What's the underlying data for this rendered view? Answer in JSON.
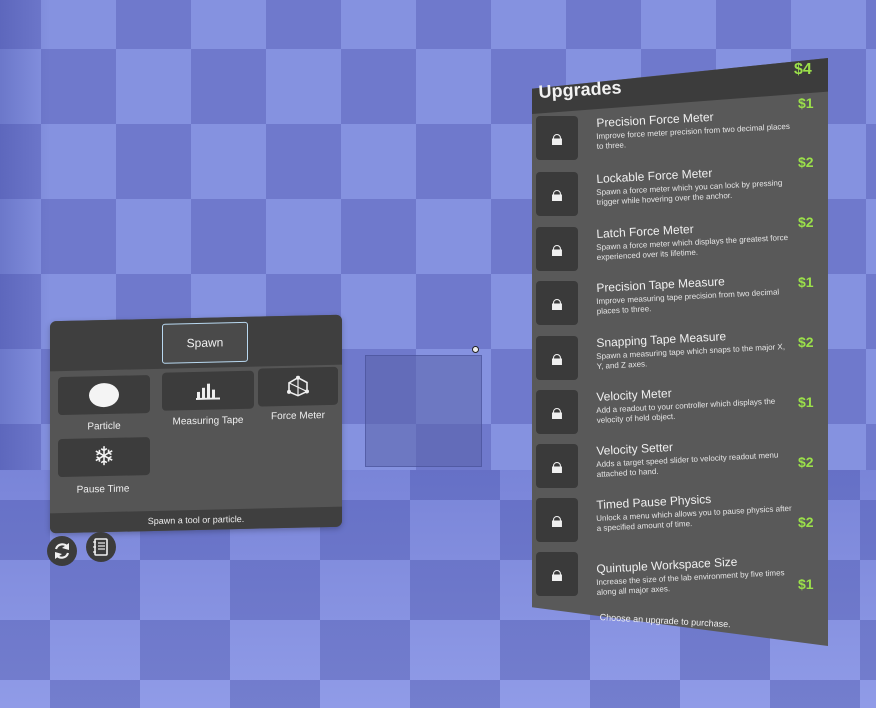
{
  "spawn_panel": {
    "tab_label": "Spawn",
    "items": [
      {
        "label": "Particle",
        "icon": "circle-icon"
      },
      {
        "label": "Measuring Tape",
        "icon": "bar-chart-icon"
      },
      {
        "label": "Force Meter",
        "icon": "force-meter-icon"
      },
      {
        "label": "Pause Time",
        "icon": "snowflake-icon"
      }
    ],
    "footer": "Spawn a tool or particle."
  },
  "bottom_buttons": [
    {
      "icon": "reset-icon"
    },
    {
      "icon": "notebook-icon"
    }
  ],
  "upgrades": {
    "title": "Upgrades",
    "balance": "$4",
    "footer": "Choose an upgrade to purchase.",
    "items": [
      {
        "name": "Precision Force Meter",
        "description": "Improve force meter precision from two decimal places to three.",
        "cost": "$1"
      },
      {
        "name": "Lockable Force Meter",
        "description": "Spawn a force meter which you can lock by pressing trigger while hovering over the anchor.",
        "cost": "$2"
      },
      {
        "name": "Latch Force Meter",
        "description": "Spawn a force meter which displays the greatest force experienced over its lifetime.",
        "cost": "$2"
      },
      {
        "name": "Precision Tape Measure",
        "description": "Improve measuring tape precision from two decimal places to three.",
        "cost": "$1"
      },
      {
        "name": "Snapping Tape Measure",
        "description": "Spawn a measuring tape which snaps to the major X, Y, and Z axes.",
        "cost": "$2"
      },
      {
        "name": "Velocity Meter",
        "description": "Add a readout to your controller which displays the velocity of held object.",
        "cost": "$1"
      },
      {
        "name": "Velocity Setter",
        "description": "Adds a target speed slider to velocity readout menu attached to hand.",
        "cost": "$2"
      },
      {
        "name": "Timed Pause Physics",
        "description": "Unlock a menu which allows you to pause physics after a specified amount of time.",
        "cost": "$2"
      },
      {
        "name": "Quintuple Workspace Size",
        "description": "Increase the size of the lab environment by five times along all major axes.",
        "cost": "$1"
      }
    ]
  },
  "colors": {
    "cost": "#9be04a",
    "panel": "#595959",
    "panel_dark": "#3c3c3c",
    "tab_border": "#b8d8f0"
  }
}
